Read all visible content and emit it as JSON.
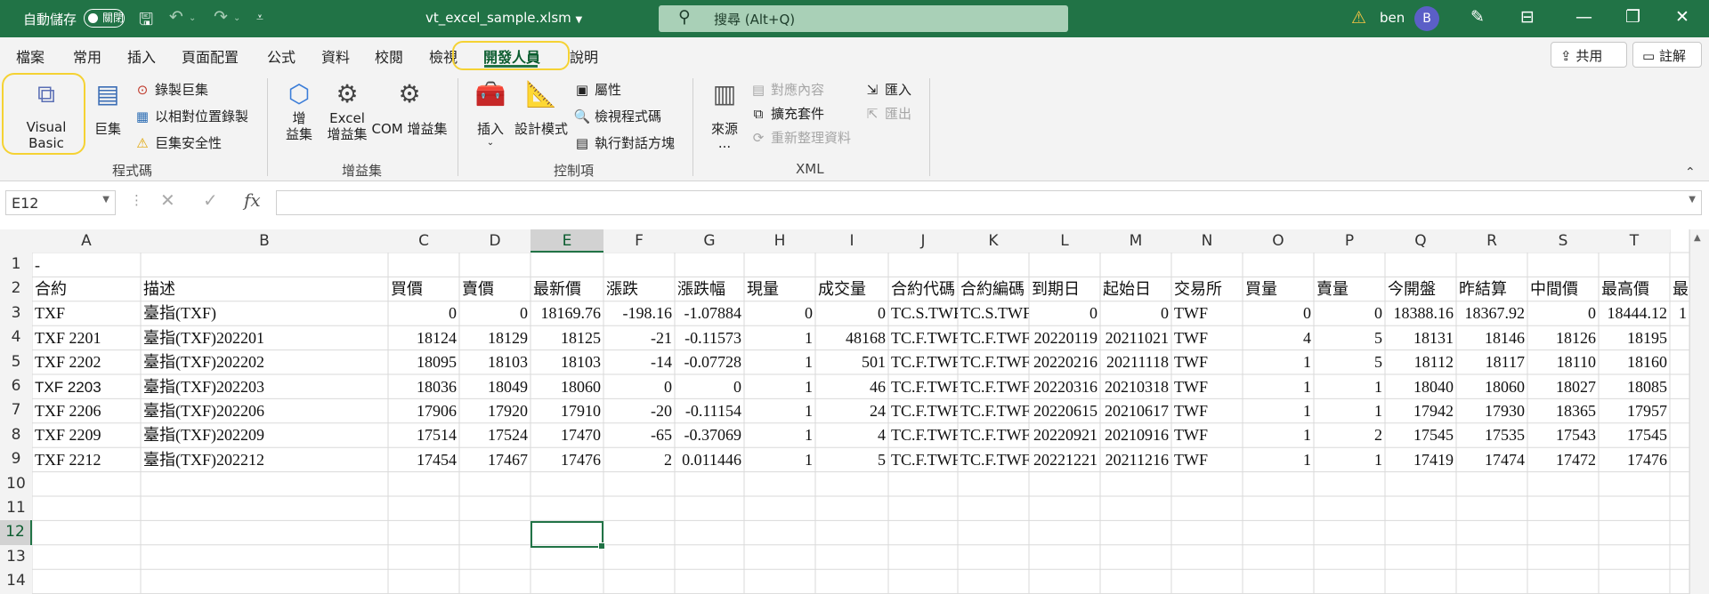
{
  "titlebar": {
    "autosave_label": "自動儲存",
    "autosave_state": "關閉",
    "filename": "vt_excel_sample.xlsm",
    "search_placeholder": "搜尋 (Alt+Q)",
    "user_name": "ben",
    "avatar_letter": "B",
    "icons": [
      "save-icon",
      "undo-icon",
      "redo-icon",
      "customize-icon",
      "warning-icon",
      "pen-icon",
      "ribbon-display-icon",
      "minimize-icon",
      "restore-icon",
      "close-icon"
    ]
  },
  "tabs": [
    {
      "label": "檔案"
    },
    {
      "label": "常用"
    },
    {
      "label": "插入"
    },
    {
      "label": "頁面配置"
    },
    {
      "label": "公式"
    },
    {
      "label": "資料"
    },
    {
      "label": "校閱"
    },
    {
      "label": "檢視"
    },
    {
      "label": "開發人員",
      "active": true
    },
    {
      "label": "說明"
    }
  ],
  "share_label": "共用",
  "comment_label": "註解",
  "ribbon": {
    "code": {
      "group_label": "程式碼",
      "visual_basic": "Visual Basic",
      "macros": "巨集",
      "record_macro": "錄製巨集",
      "relative_ref": "以相對位置錄製",
      "macro_security": "巨集安全性"
    },
    "addins": {
      "group_label": "增益集",
      "addins_1": "增",
      "addins_2": "益集",
      "excel_addins_1": "Excel",
      "excel_addins_2": "增益集",
      "com_addins": "COM 增益集"
    },
    "controls": {
      "group_label": "控制項",
      "insert": "插入",
      "design_mode": "設計模式",
      "properties": "屬性",
      "view_code": "檢視程式碼",
      "run_dialog": "執行對話方塊"
    },
    "xml": {
      "group_label": "XML",
      "source_1": "來源",
      "source_2": "...",
      "map_properties": "對應內容",
      "expansion_packs": "擴充套件",
      "refresh_data": "重新整理資料",
      "import": "匯入",
      "export": "匯出"
    }
  },
  "formula_bar": {
    "name_box": "E12",
    "cancel": "✕",
    "enter": "✓",
    "fx": "fx",
    "value": ""
  },
  "sheet": {
    "columns": [
      "A",
      "B",
      "C",
      "D",
      "E",
      "F",
      "G",
      "H",
      "I",
      "J",
      "K",
      "L",
      "M",
      "N",
      "O",
      "P",
      "Q",
      "R",
      "S",
      "T"
    ],
    "rows": [
      "1",
      "2",
      "3",
      "4",
      "5",
      "6",
      "7",
      "8",
      "9",
      "10",
      "11",
      "12",
      "13",
      "14"
    ],
    "selected_col": "E",
    "selected_row": "12",
    "a1": "-",
    "headers": [
      "合約",
      "描述",
      "買價",
      "賣價",
      "最新價",
      "漲跌",
      "漲跌幅",
      "現量",
      "成交量",
      "合約代碼",
      "合約編碼",
      "到期日",
      "起始日",
      "交易所",
      "買量",
      "賣量",
      "今開盤",
      "昨結算",
      "中間價",
      "最高價",
      "最"
    ],
    "data": [
      [
        "TXF",
        "臺指(TXF)",
        "0",
        "0",
        "18169.76",
        "-198.16",
        "-1.07884",
        "0",
        "0",
        "TC.S.TWF",
        "TC.S.TWF",
        "0",
        "0",
        "TWF",
        "0",
        "0",
        "18388.16",
        "18367.92",
        "0",
        "18444.12",
        "1"
      ],
      [
        "TXF 2201",
        "臺指(TXF)202201",
        "18124",
        "18129",
        "18125",
        "-21",
        "-0.11573",
        "1",
        "48168",
        "TC.F.TWF",
        "TC.F.TWF",
        "20220119",
        "20211021",
        "TWF",
        "4",
        "5",
        "18131",
        "18146",
        "18126",
        "18195",
        ""
      ],
      [
        "TXF 2202",
        "臺指(TXF)202202",
        "18095",
        "18103",
        "18103",
        "-14",
        "-0.07728",
        "1",
        "501",
        "TC.F.TWF",
        "TC.F.TWF",
        "20220216",
        "20211118",
        "TWF",
        "1",
        "5",
        "18112",
        "18117",
        "18110",
        "18160",
        ""
      ],
      [
        "TXF 2203",
        "臺指(TXF)202203",
        "18036",
        "18049",
        "18060",
        "0",
        "0",
        "1",
        "46",
        "TC.F.TWF",
        "TC.F.TWF",
        "20220316",
        "20210318",
        "TWF",
        "1",
        "1",
        "18040",
        "18060",
        "18027",
        "18085",
        ""
      ],
      [
        "TXF 2206",
        "臺指(TXF)202206",
        "17906",
        "17920",
        "17910",
        "-20",
        "-0.11154",
        "1",
        "24",
        "TC.F.TWF",
        "TC.F.TWF",
        "20220615",
        "20210617",
        "TWF",
        "1",
        "1",
        "17942",
        "17930",
        "18365",
        "17957",
        ""
      ],
      [
        "TXF 2209",
        "臺指(TXF)202209",
        "17514",
        "17524",
        "17470",
        "-65",
        "-0.37069",
        "1",
        "4",
        "TC.F.TWF",
        "TC.F.TWF",
        "20220921",
        "20210916",
        "TWF",
        "1",
        "2",
        "17545",
        "17535",
        "17543",
        "17545",
        ""
      ],
      [
        "TXF 2212",
        "臺指(TXF)202212",
        "17454",
        "17467",
        "17476",
        "2",
        "0.011446",
        "1",
        "5",
        "TC.F.TWF",
        "TC.F.TWF",
        "20221221",
        "20211216",
        "TWF",
        "1",
        "1",
        "17419",
        "17474",
        "17472",
        "17476",
        ""
      ]
    ]
  }
}
